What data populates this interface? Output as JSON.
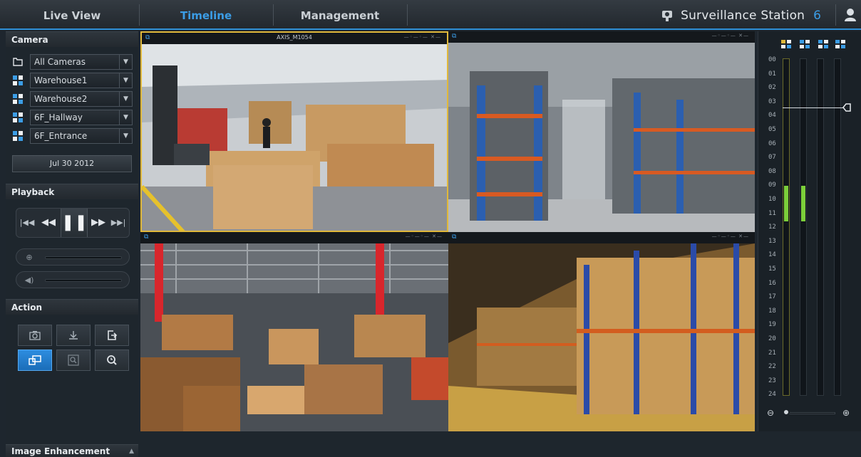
{
  "topbar": {
    "tabs": [
      {
        "label": "Live View",
        "active": false
      },
      {
        "label": "Timeline",
        "active": true
      },
      {
        "label": "Management",
        "active": false
      }
    ],
    "brand": "Surveillance Station",
    "version": "6",
    "user_icon": "user-icon"
  },
  "camera_panel": {
    "title": "Camera",
    "cameras": [
      {
        "label": "All Cameras",
        "icon": "folder-icon"
      },
      {
        "label": "Warehouse1",
        "icon": "layout-grid-icon"
      },
      {
        "label": "Warehouse2",
        "icon": "layout-grid-icon"
      },
      {
        "label": "6F_Hallway",
        "icon": "layout-grid-icon"
      },
      {
        "label": "6F_Entrance",
        "icon": "layout-grid-icon"
      }
    ],
    "date": "Jul 30 2012"
  },
  "playback_panel": {
    "title": "Playback"
  },
  "action_panel": {
    "title": "Action"
  },
  "image_enhancement": {
    "title": "Image Enhancement"
  },
  "video": {
    "tiles": [
      {
        "name": "AXIS_M1054",
        "selected": true
      },
      {
        "name": "",
        "selected": false
      },
      {
        "name": "",
        "selected": false
      },
      {
        "name": "",
        "selected": false
      }
    ]
  },
  "timeline": {
    "hours": [
      "00",
      "01",
      "02",
      "03",
      "04",
      "05",
      "06",
      "07",
      "08",
      "09",
      "10",
      "11",
      "12",
      "13",
      "14",
      "15",
      "16",
      "17",
      "18",
      "19",
      "20",
      "21",
      "22",
      "23",
      "24"
    ],
    "zoom_level": 0.0
  },
  "colors": {
    "accent": "#3b9de6",
    "selected_border": "#e0b83a",
    "recording": "#7ccf3a"
  }
}
